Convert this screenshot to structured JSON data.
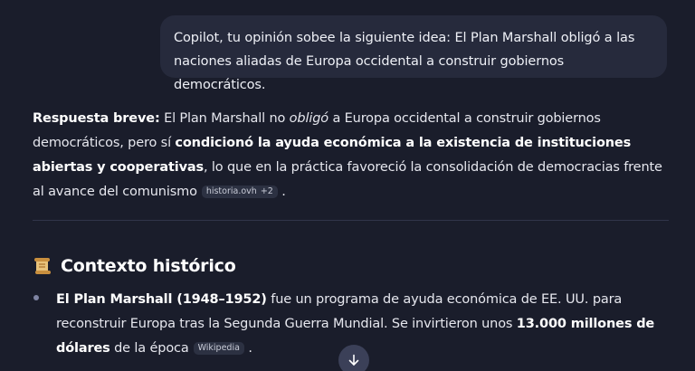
{
  "user_message": "Copilot, tu opinión sobee la siguiente idea: El Plan Marshall obligó a las naciones aliadas de Europa occidental a construir gobiernos democráticos.",
  "answer": {
    "label": "Respuesta breve:",
    "t1": " El Plan Marshall no ",
    "em": "obligó",
    "t2": " a Europa occidental a construir gobiernos democráticos, pero sí ",
    "bold": "condicionó la ayuda económica a la existencia de instituciones abiertas y cooperativas",
    "t3": ", lo que en la práctica favoreció la consolidación de democracias frente al avance del comunismo",
    "citation": {
      "source": "historia.ovh",
      "more": "+2"
    },
    "end": "."
  },
  "section": {
    "icon": "scroll-icon",
    "title": "Contexto histórico"
  },
  "bullet1": {
    "bold": "El Plan Marshall (1948–1952)",
    "t1": " fue un programa de ayuda económica de EE. UU. para reconstruir Europa tras la Segunda Guerra Mundial. Se invirtieron unos ",
    "bold2": "13.000 millones de dólares",
    "t2": " de la época",
    "citation": "Wikipedia",
    "end": " ."
  },
  "scroll_button": {
    "icon": "arrow-down-icon"
  },
  "colors": {
    "background": "#1a1d2b",
    "user_bubble": "#262a3c",
    "citation_chip": "#2c3142",
    "scroll_button": "#3b4058"
  }
}
